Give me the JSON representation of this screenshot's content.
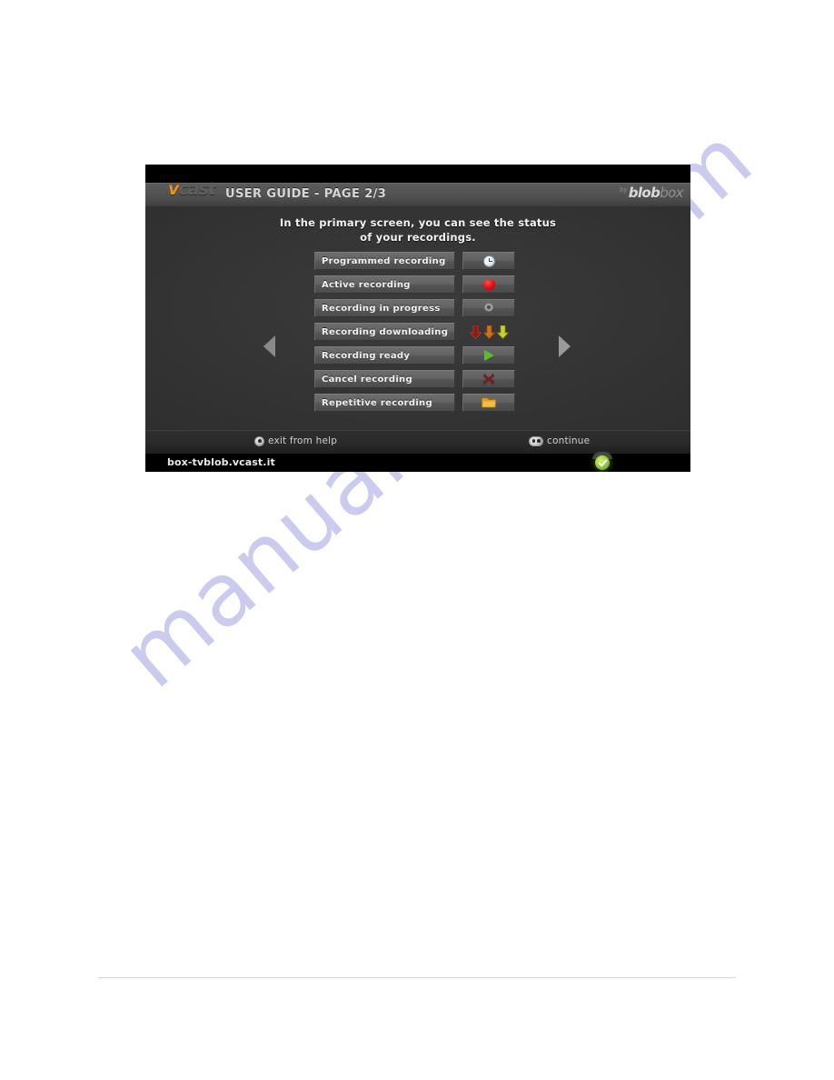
{
  "page": {
    "watermark": "manualshive.com",
    "background_color": "#ffffff",
    "rule_color": "#d7d7d7"
  },
  "tv": {
    "header": {
      "brand_v": "v",
      "brand_cast": "cast",
      "title": "USER GUIDE - PAGE 2/3",
      "partner_by": "by",
      "partner_name_bold": "blob",
      "partner_name_light": "box"
    },
    "intro": {
      "line1": "In the primary screen, you can see the status",
      "line2": "of your recordings."
    },
    "status_rows": [
      {
        "label": "Programmed recording",
        "icon": "clock-icon",
        "icon_color": "#e7eef5"
      },
      {
        "label": "Active recording",
        "icon": "red-dot-icon",
        "icon_color": "#e01010"
      },
      {
        "label": "Recording in progress",
        "icon": "gear-spinner-icon",
        "icon_color": "#9a9a9a"
      },
      {
        "label": "Recording downloading",
        "icon": "download-arrows-icon",
        "icon_color": "#c8331f"
      },
      {
        "label": "Recording ready",
        "icon": "play-icon",
        "icon_color": "#5bbd2a"
      },
      {
        "label": "Cancel recording",
        "icon": "x-cancel-icon",
        "icon_color": "#8c1f1f"
      },
      {
        "label": "Repetitive recording",
        "icon": "folder-icon",
        "icon_color": "#e8a31b"
      }
    ],
    "nav": {
      "prev": "previous-page-arrow",
      "next": "next-page-arrow"
    },
    "actions": {
      "exit_label": "exit from help",
      "continue_label": "continue"
    },
    "statusbar": {
      "url": "box-tvblob.vcast.it",
      "indicator": "green-check-icon"
    }
  }
}
